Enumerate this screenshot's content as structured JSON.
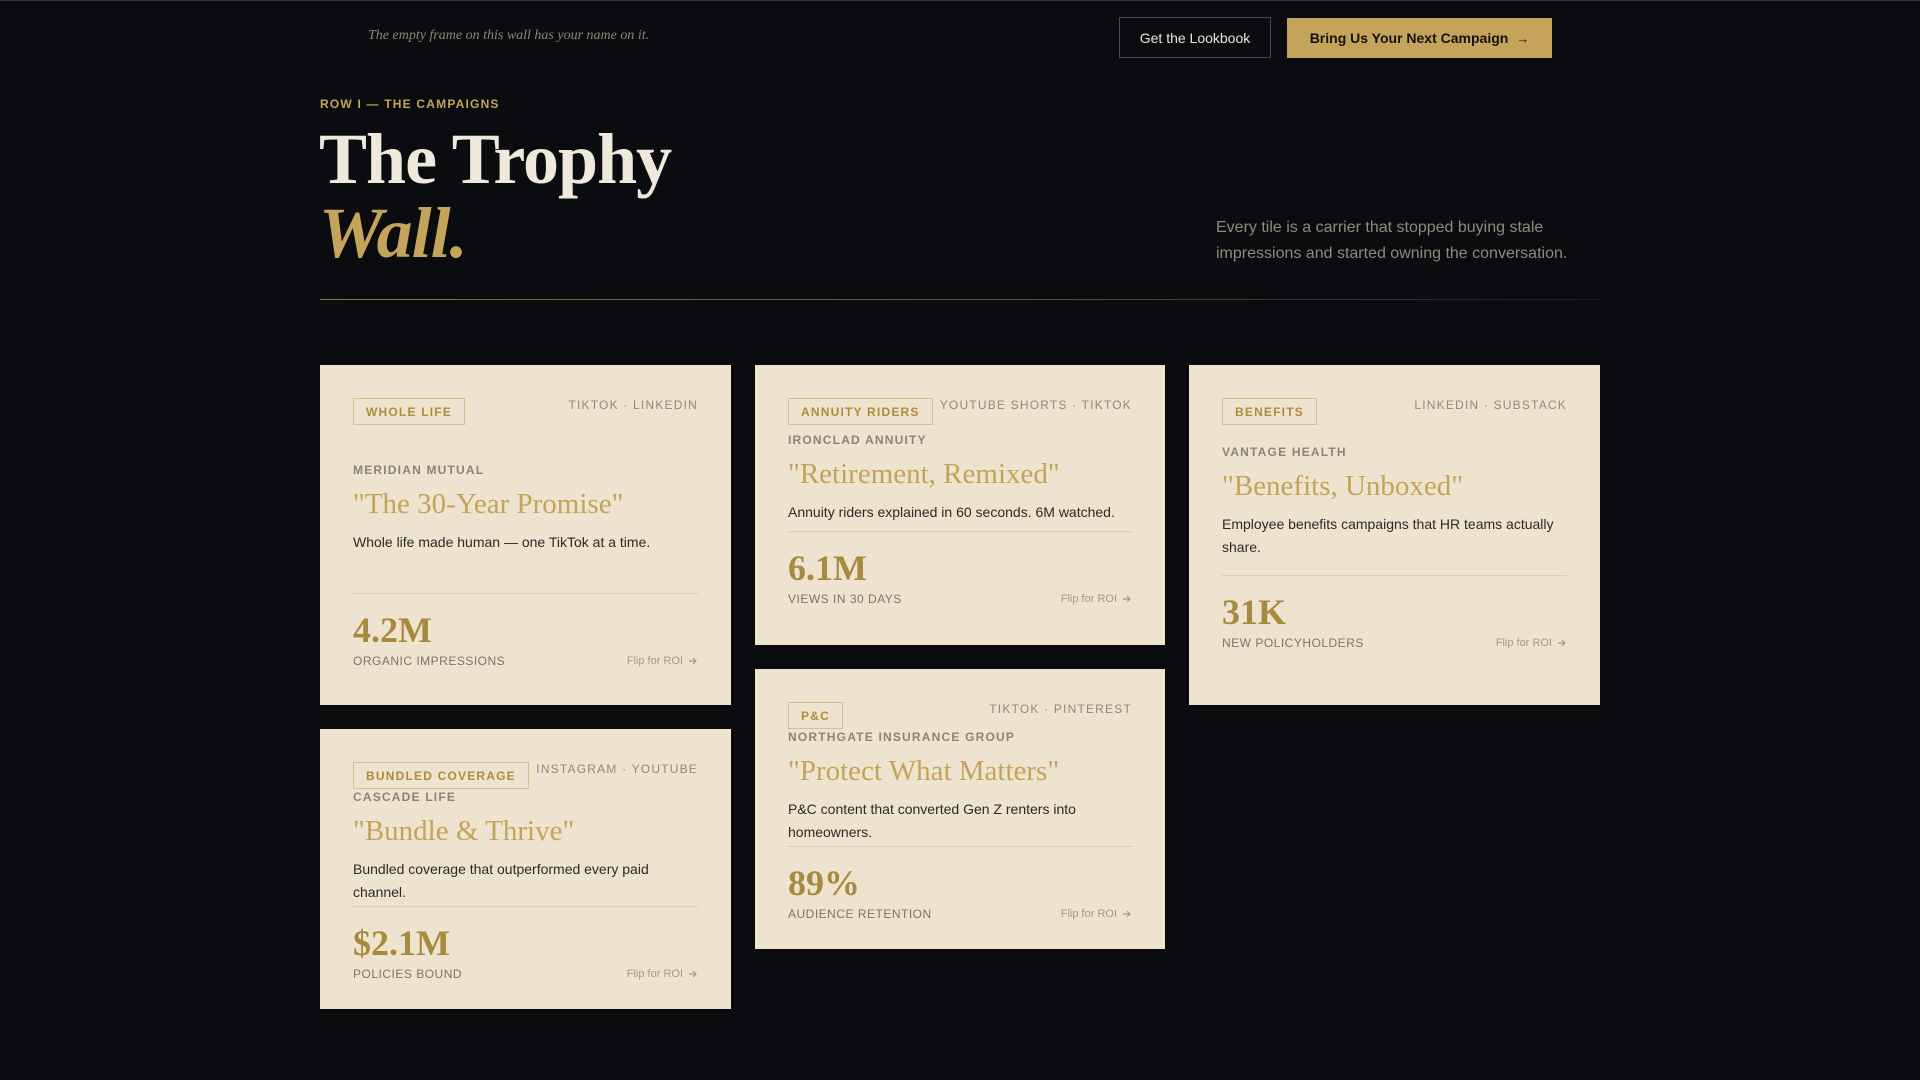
{
  "topbar": {
    "tagline": "The empty frame on this wall has your name on it.",
    "lookbook_label": "Get the Lookbook",
    "campaign_label": "Bring Us Your Next Campaign",
    "campaign_arrow": "→"
  },
  "header": {
    "eyebrow": "ROW I — THE CAMPAIGNS",
    "title_line1": "The Trophy",
    "title_line2": "Wall.",
    "intro": "Every tile is a carrier that stopped buying stale impressions and started owning the conversation."
  },
  "cards": [
    {
      "badge": "WHOLE LIFE",
      "platforms": "TIKTOK · LINKEDIN",
      "company": "MERIDIAN MUTUAL",
      "headline": "\"The 30-Year Promise\"",
      "description": "Whole life made human — one TikTok at a time.",
      "metric": "4.2M",
      "metric_label": "ORGANIC IMPRESSIONS",
      "flip_label": "Flip for ROI"
    },
    {
      "badge": "ANNUITY RIDERS",
      "platforms": "YOUTUBE SHORTS · TIKTOK",
      "company": "IRONCLAD ANNUITY",
      "headline": "\"Retirement, Remixed\"",
      "description": "Annuity riders explained in 60 seconds. 6M watched.",
      "metric": "6.1M",
      "metric_label": "VIEWS IN 30 DAYS",
      "flip_label": "Flip for ROI"
    },
    {
      "badge": "BENEFITS",
      "platforms": "LINKEDIN · SUBSTACK",
      "company": "VANTAGE HEALTH",
      "headline": "\"Benefits, Unboxed\"",
      "description": "Employee benefits campaigns that HR teams actually share.",
      "metric": "31K",
      "metric_label": "NEW POLICYHOLDERS",
      "flip_label": "Flip for ROI"
    },
    {
      "badge": "BUNDLED COVERAGE",
      "platforms": "INSTAGRAM · YOUTUBE",
      "company": "CASCADE LIFE",
      "headline": "\"Bundle & Thrive\"",
      "description": "Bundled coverage that outperformed every paid channel.",
      "metric": "$2.1M",
      "metric_label": "POLICIES BOUND",
      "flip_label": "Flip for ROI"
    },
    {
      "badge": "P&C",
      "platforms": "TIKTOK · PINTEREST",
      "company": "NORTHGATE INSURANCE GROUP",
      "headline": "\"Protect What Matters\"",
      "description": "P&C content that converted Gen Z renters into homeowners.",
      "metric": "89%",
      "metric_label": "AUDIENCE RETENTION",
      "flip_label": "Flip for ROI"
    }
  ],
  "colors": {
    "background": "#0b0c0f",
    "gold": "#c4a35a",
    "card": "#ede3cf"
  },
  "icons": {
    "flip": "arrow-right-icon"
  }
}
